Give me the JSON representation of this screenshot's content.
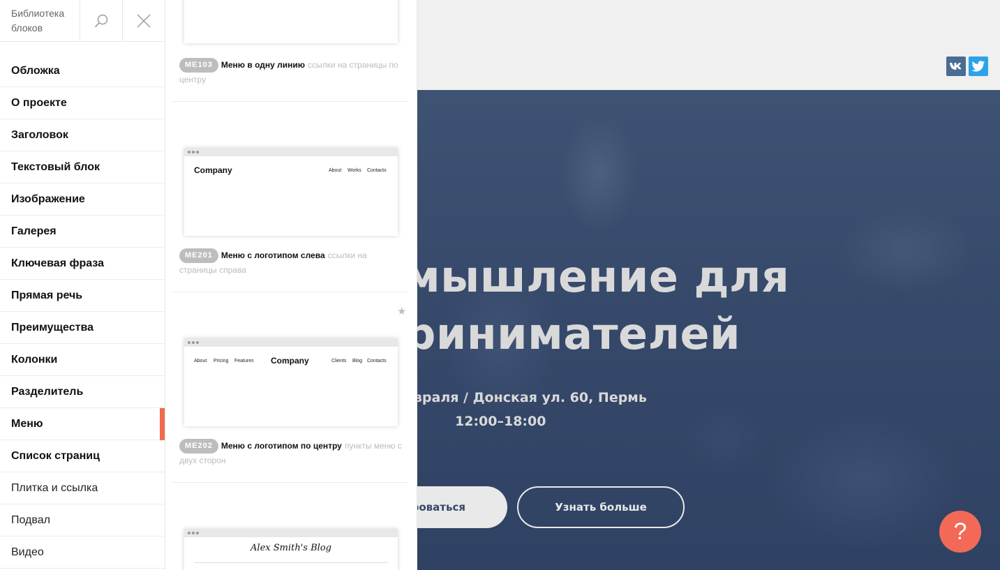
{
  "library": {
    "title": "Библиотека блоков",
    "search_icon": "search-icon",
    "close_icon": "close-icon"
  },
  "categories": [
    {
      "label": "Обложка"
    },
    {
      "label": "О проекте"
    },
    {
      "label": "Заголовок"
    },
    {
      "label": "Текстовый блок"
    },
    {
      "label": "Изображение"
    },
    {
      "label": "Галерея"
    },
    {
      "label": "Ключевая фраза"
    },
    {
      "label": "Прямая речь"
    },
    {
      "label": "Преимущества"
    },
    {
      "label": "Колонки"
    },
    {
      "label": "Разделитель"
    },
    {
      "label": "Меню",
      "active": true
    },
    {
      "label": "Список страниц"
    },
    {
      "label": "Плитка и ссылка"
    },
    {
      "label": "Подвал"
    },
    {
      "label": "Видео"
    }
  ],
  "blocks": [
    {
      "code": "ME103",
      "name": "Меню в одну линию",
      "desc": "ссылки на страницы по центру"
    },
    {
      "code": "ME201",
      "name": "Меню с логотипом слева",
      "desc": "ссылки на страницы справа",
      "preview": {
        "company": "Company",
        "links": [
          "About",
          "Works",
          "Contacts"
        ]
      }
    },
    {
      "code": "ME202",
      "name": "Меню с логотипом по центру",
      "desc": "пункты меню с двух сторон",
      "preview": {
        "company": "Company",
        "left_links": [
          "About",
          "Pricing",
          "Features"
        ],
        "right_links": [
          "Clients",
          "Blog",
          "Contacts"
        ]
      }
    },
    {
      "preview": {
        "blog_title": "Alex Smith's Blog"
      }
    }
  ],
  "favorite_icon": "star-icon",
  "preview_page": {
    "social": [
      "vk-icon",
      "twitter-icon"
    ],
    "title_line1": "мышление для",
    "title_line2": "ринимателей",
    "subtitle_line1": "евраля / Донская ул. 60, Пермь",
    "subtitle_line2": "12:00–18:00",
    "primary_button": "роваться",
    "secondary_button": "Узнать больше",
    "help_button": "?"
  },
  "colors": {
    "accent": "#f26a4a",
    "help": "#f26a57",
    "hero_overlay": "#36496a",
    "vk": "#4a6c92",
    "twitter": "#2aa3e8",
    "badge": "#bdbdbd"
  }
}
